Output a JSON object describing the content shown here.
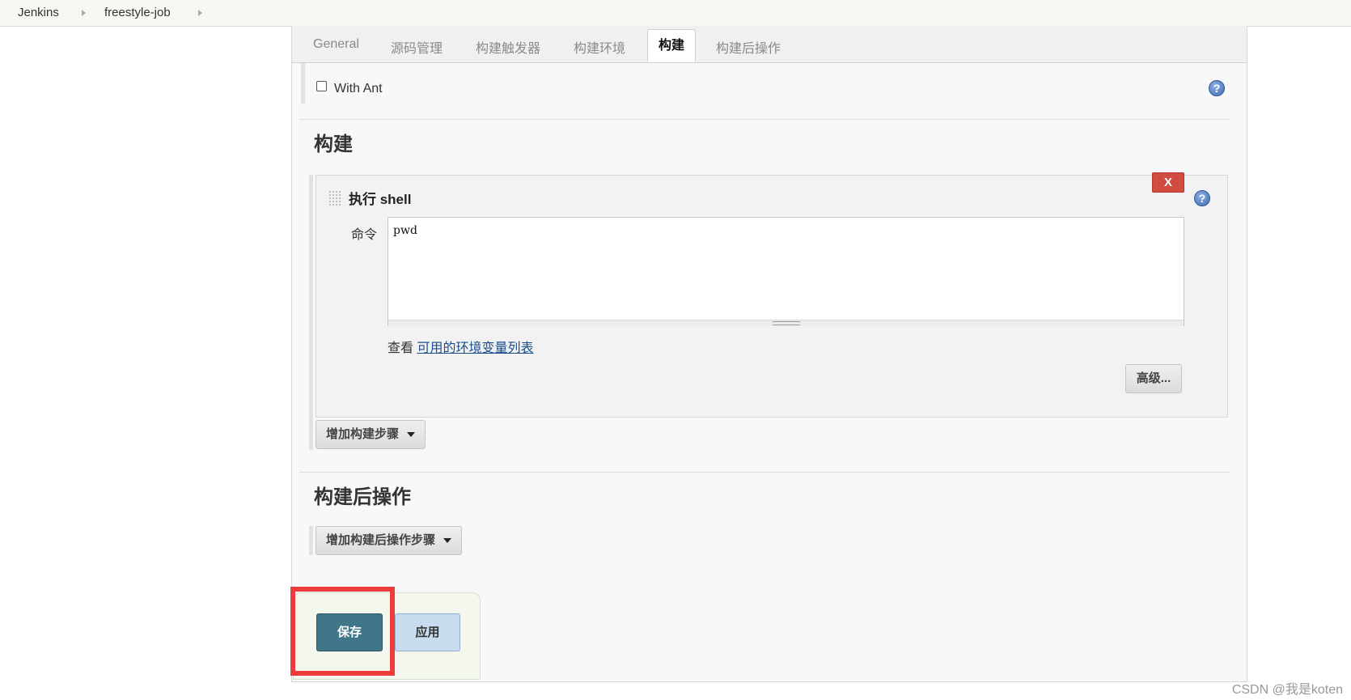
{
  "breadcrumb": {
    "items": [
      "Jenkins",
      "freestyle-job"
    ]
  },
  "tabs": [
    {
      "label": "General",
      "active": false
    },
    {
      "label": "源码管理",
      "active": false
    },
    {
      "label": "构建触发器",
      "active": false
    },
    {
      "label": "构建环境",
      "active": false
    },
    {
      "label": "构建",
      "active": true
    },
    {
      "label": "构建后操作",
      "active": false
    }
  ],
  "build_env": {
    "with_ant_label": "With Ant",
    "with_ant_checked": false
  },
  "build_section": {
    "title": "构建",
    "step": {
      "title": "执行 shell",
      "delete_label": "X",
      "command_label": "命令",
      "command_value": "pwd",
      "env_prefix": "查看",
      "env_link": "可用的环境变量列表",
      "advanced_label": "高级..."
    },
    "add_step_label": "增加构建步骤"
  },
  "post_build_section": {
    "title": "构建后操作",
    "add_step_label": "增加构建后操作步骤"
  },
  "footer": {
    "save_label": "保存",
    "apply_label": "应用"
  },
  "watermark": "CSDN @我是koten",
  "colors": {
    "save_button": "#3f7688",
    "apply_button": "#c9dcef",
    "delete_button": "#d24b3f",
    "highlight": "#ee3b3b"
  }
}
